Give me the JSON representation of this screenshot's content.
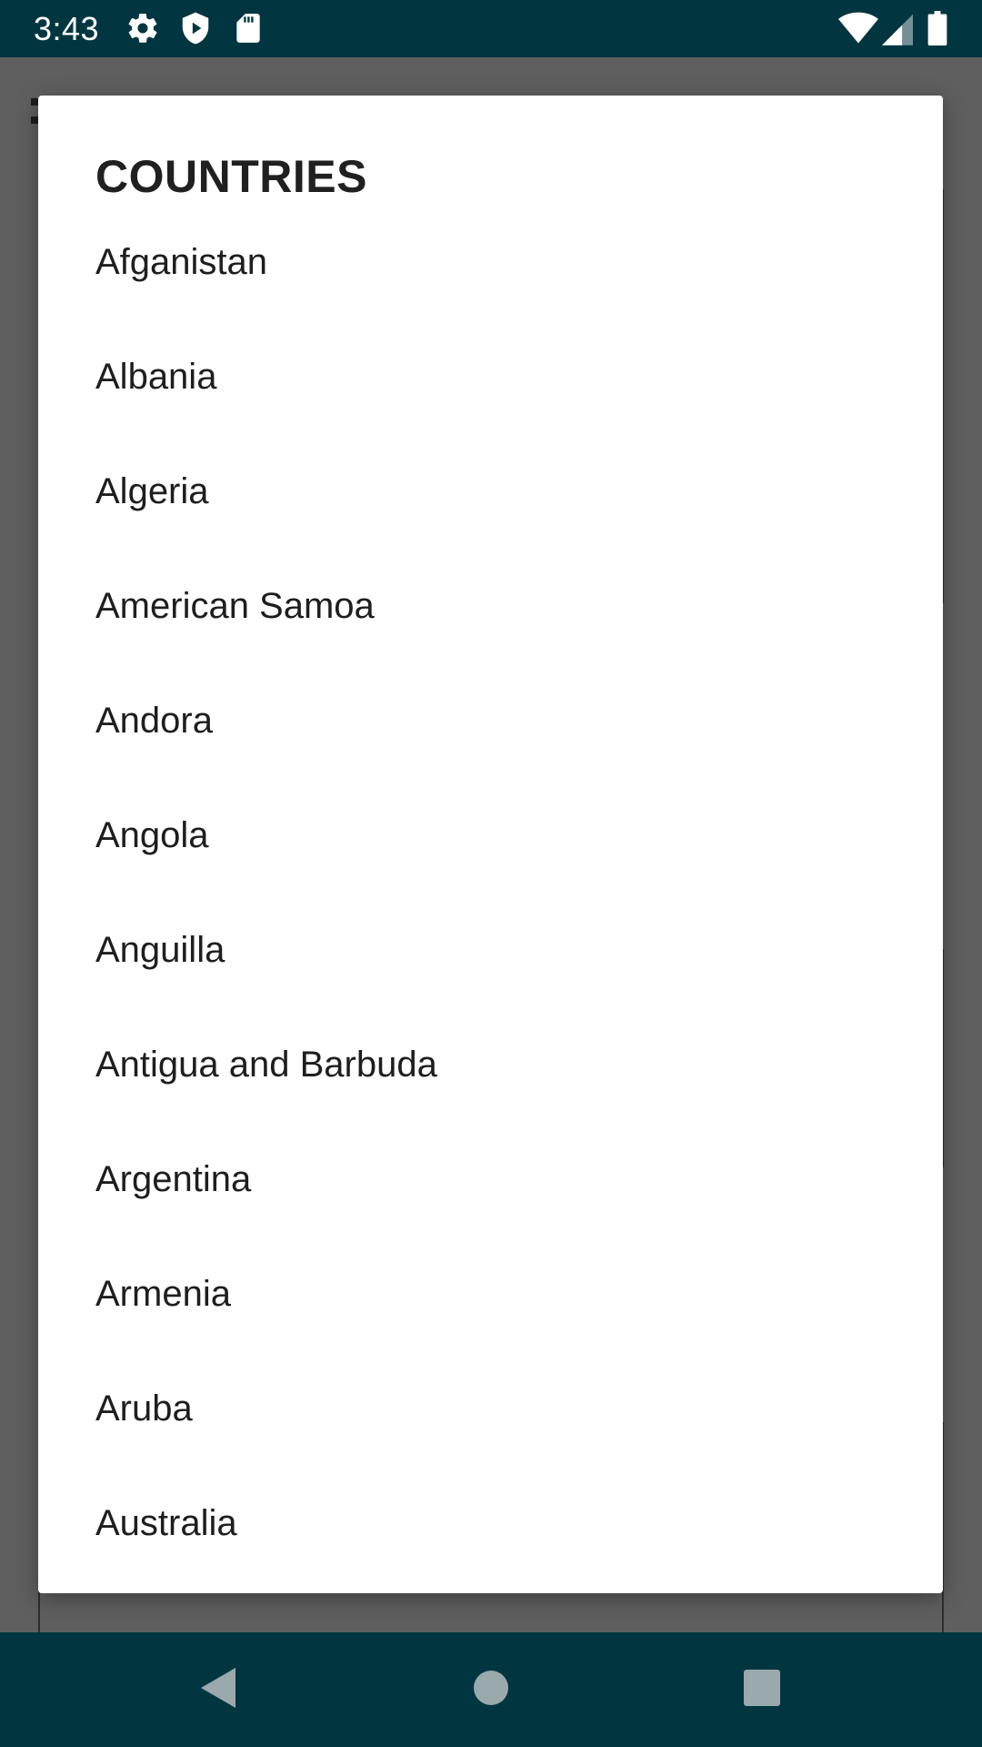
{
  "status_bar": {
    "time": "3:43",
    "left_icons": [
      "gear-icon",
      "shield-play-icon",
      "sd-card-icon"
    ],
    "right_icons": [
      "wifi-icon",
      "cell-signal-icon",
      "battery-icon"
    ]
  },
  "dialog": {
    "title": "COUNTRIES",
    "items": [
      {
        "label": "Afganistan"
      },
      {
        "label": "Albania"
      },
      {
        "label": "Algeria"
      },
      {
        "label": "American Samoa"
      },
      {
        "label": "Andora"
      },
      {
        "label": "Angola"
      },
      {
        "label": "Anguilla"
      },
      {
        "label": "Antigua and Barbuda"
      },
      {
        "label": "Argentina"
      },
      {
        "label": "Armenia"
      },
      {
        "label": "Aruba"
      },
      {
        "label": "Australia"
      }
    ]
  },
  "nav_bar": {
    "buttons": [
      "back-icon",
      "home-icon",
      "recents-icon"
    ]
  },
  "colors": {
    "system_bar": "#013640",
    "scrim": "#6b6b6b",
    "dialog_bg": "#ffffff",
    "text": "#1e1e1e"
  }
}
